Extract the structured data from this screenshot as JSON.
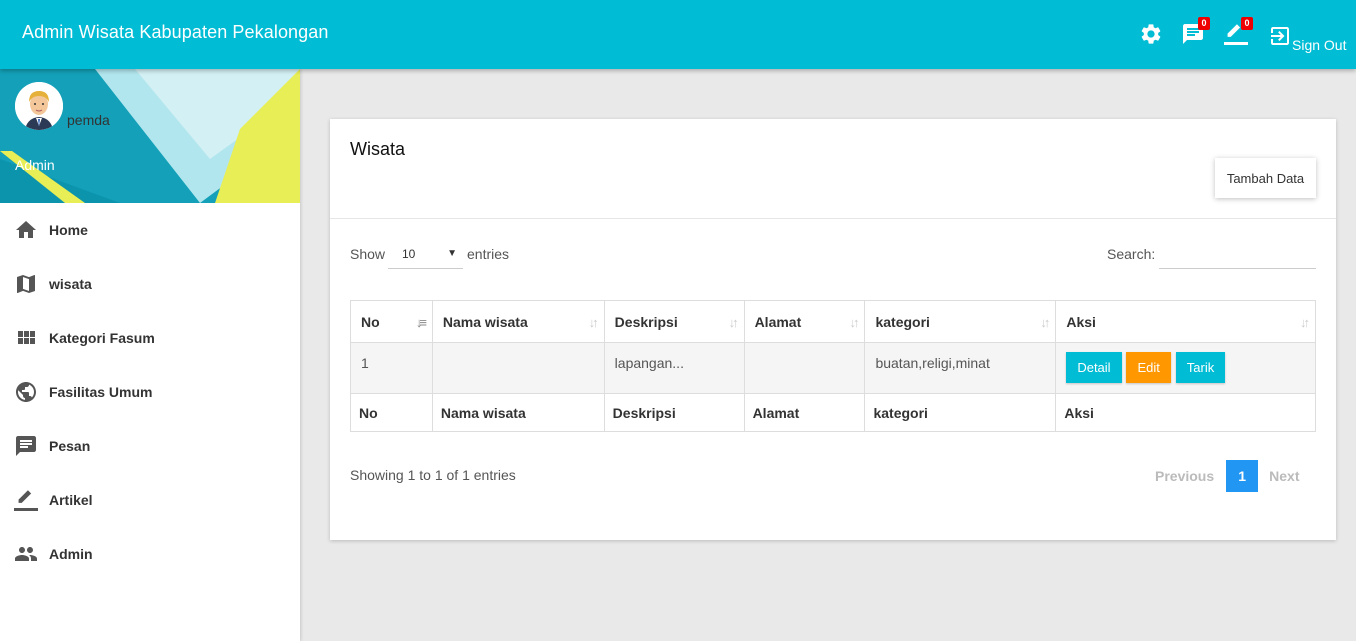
{
  "header": {
    "brand": "Admin Wisata Kabupaten Pekalongan",
    "messages_badge": "0",
    "articles_badge": "0",
    "signout_label": "Sign Out"
  },
  "user": {
    "name": "pemda",
    "role": "Admin"
  },
  "sidebar": {
    "items": [
      {
        "label": "Home",
        "icon": "home-icon"
      },
      {
        "label": "wisata",
        "icon": "map-icon"
      },
      {
        "label": "Kategori Fasum",
        "icon": "grid-icon"
      },
      {
        "label": "Fasilitas Umum",
        "icon": "globe-icon"
      },
      {
        "label": "Pesan",
        "icon": "message-icon"
      },
      {
        "label": "Artikel",
        "icon": "edit-icon"
      },
      {
        "label": "Admin",
        "icon": "people-icon"
      }
    ]
  },
  "card": {
    "title": "Wisata",
    "add_button": "Tambah Data",
    "show_label": "Show",
    "page_size": "10",
    "entries_label": "entries",
    "search_label": "Search:",
    "search_value": "",
    "columns": [
      "No",
      "Nama wisata",
      "Deskripsi",
      "Alamat",
      "kategori",
      "Aksi"
    ],
    "rows": [
      {
        "no": "1",
        "nama": "",
        "deskripsi": "lapangan...",
        "alamat": "",
        "kategori": "buatan,religi,minat"
      }
    ],
    "actions": {
      "detail": "Detail",
      "edit": "Edit",
      "tarik": "Tarik"
    },
    "info": "Showing 1 to 1 of 1 entries",
    "pagination": {
      "previous": "Previous",
      "current": "1",
      "next": "Next"
    }
  }
}
